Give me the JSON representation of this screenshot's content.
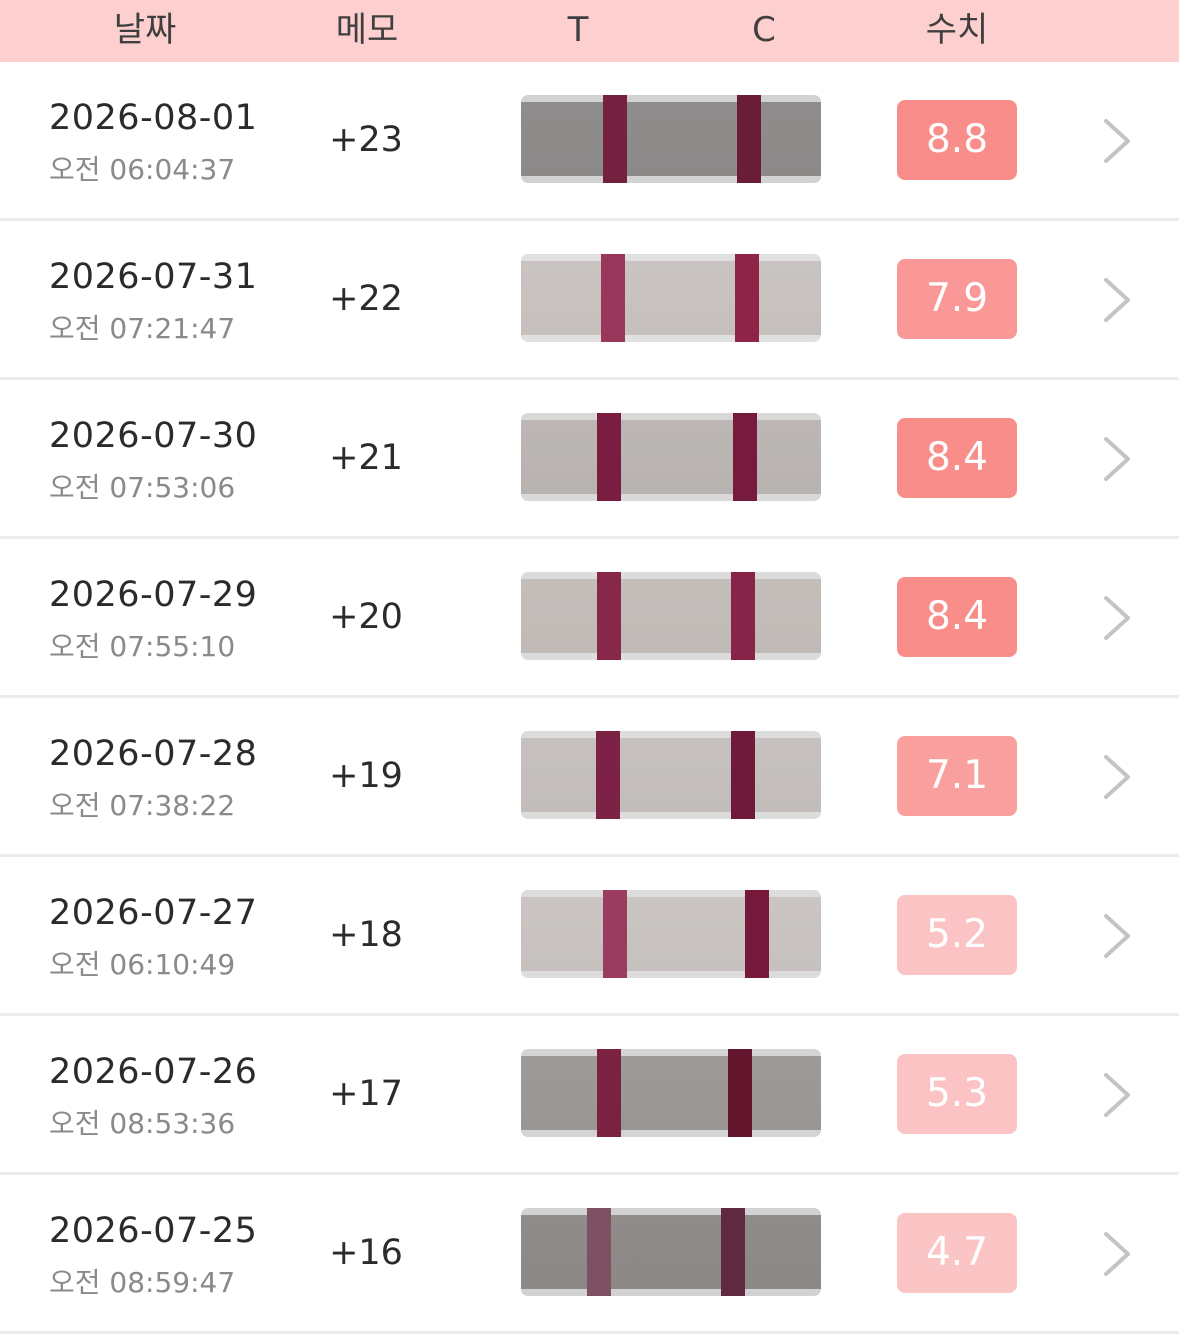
{
  "header": {
    "date": "날짜",
    "memo": "메모",
    "t": "T",
    "c": "C",
    "value": "수치"
  },
  "colors": {
    "header_bg": "#fdcfcf",
    "value_high": "#f98b87",
    "value_low": "#fbc4c4",
    "band": "#8c1d45"
  },
  "rows": [
    {
      "date": "2026-08-01",
      "time": "오전 06:04:37",
      "memo": "+23",
      "value": "8.8"
    },
    {
      "date": "2026-07-31",
      "time": "오전 07:21:47",
      "memo": "+22",
      "value": "7.9"
    },
    {
      "date": "2026-07-30",
      "time": "오전 07:53:06",
      "memo": "+21",
      "value": "8.4"
    },
    {
      "date": "2026-07-29",
      "time": "오전 07:55:10",
      "memo": "+20",
      "value": "8.4"
    },
    {
      "date": "2026-07-28",
      "time": "오전 07:38:22",
      "memo": "+19",
      "value": "7.1"
    },
    {
      "date": "2026-07-27",
      "time": "오전 06:10:49",
      "memo": "+18",
      "value": "5.2"
    },
    {
      "date": "2026-07-26",
      "time": "오전 08:53:36",
      "memo": "+17",
      "value": "5.3"
    },
    {
      "date": "2026-07-25",
      "time": "오전 08:59:47",
      "memo": "+16",
      "value": "4.7"
    }
  ]
}
